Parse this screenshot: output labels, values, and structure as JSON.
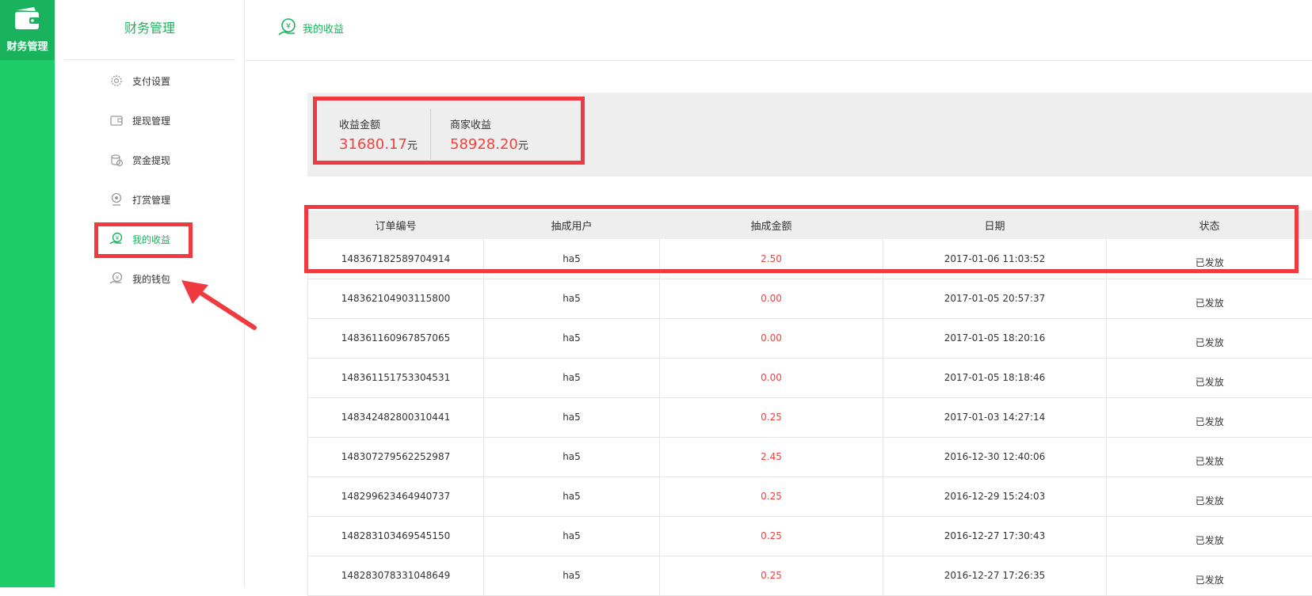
{
  "rail": {
    "label": "财务管理",
    "icon": "wallet-icon",
    "accent": "#1ecc6a"
  },
  "subnav": {
    "title": "财务管理",
    "items": [
      {
        "label": "支付设置",
        "icon": "gear-icon",
        "active": false
      },
      {
        "label": "提现管理",
        "icon": "wallet-icon",
        "active": false
      },
      {
        "label": "赏金提现",
        "icon": "coins-icon",
        "active": false
      },
      {
        "label": "打赏管理",
        "icon": "reward-icon",
        "active": false
      },
      {
        "label": "我的收益",
        "icon": "income-icon",
        "active": true
      },
      {
        "label": "我的钱包",
        "icon": "purse-icon",
        "active": false
      }
    ]
  },
  "header": {
    "title": "我的收益",
    "icon": "income-icon"
  },
  "summary": {
    "income": {
      "label": "收益金额",
      "value": "31680.17",
      "unit": "元"
    },
    "merchant": {
      "label": "商家收益",
      "value": "58928.20",
      "unit": "元"
    }
  },
  "table": {
    "columns": [
      "订单编号",
      "抽成用户",
      "抽成金额",
      "日期",
      "状态"
    ],
    "rows": [
      [
        "148367182589704914",
        "ha5",
        "2.50",
        "2017-01-06 11:03:52",
        "已发放"
      ],
      [
        "148362104903115800",
        "ha5",
        "0.00",
        "2017-01-05 20:57:37",
        "已发放"
      ],
      [
        "148361160967857065",
        "ha5",
        "0.00",
        "2017-01-05 18:20:16",
        "已发放"
      ],
      [
        "148361151753304531",
        "ha5",
        "0.00",
        "2017-01-05 18:18:46",
        "已发放"
      ],
      [
        "148342482800310441",
        "ha5",
        "0.25",
        "2017-01-03 14:27:14",
        "已发放"
      ],
      [
        "148307279562252987",
        "ha5",
        "2.45",
        "2016-12-30 12:40:06",
        "已发放"
      ],
      [
        "148299623464940737",
        "ha5",
        "0.25",
        "2016-12-29 15:24:03",
        "已发放"
      ],
      [
        "148283103469545150",
        "ha5",
        "0.25",
        "2016-12-27 17:30:43",
        "已发放"
      ],
      [
        "148283078331048649",
        "ha5",
        "0.25",
        "2016-12-27 17:26:35",
        "已发放"
      ]
    ]
  },
  "colors": {
    "accent": "#1ab35d",
    "amount": "#f0413d",
    "annotation": "#ef3a3f"
  }
}
